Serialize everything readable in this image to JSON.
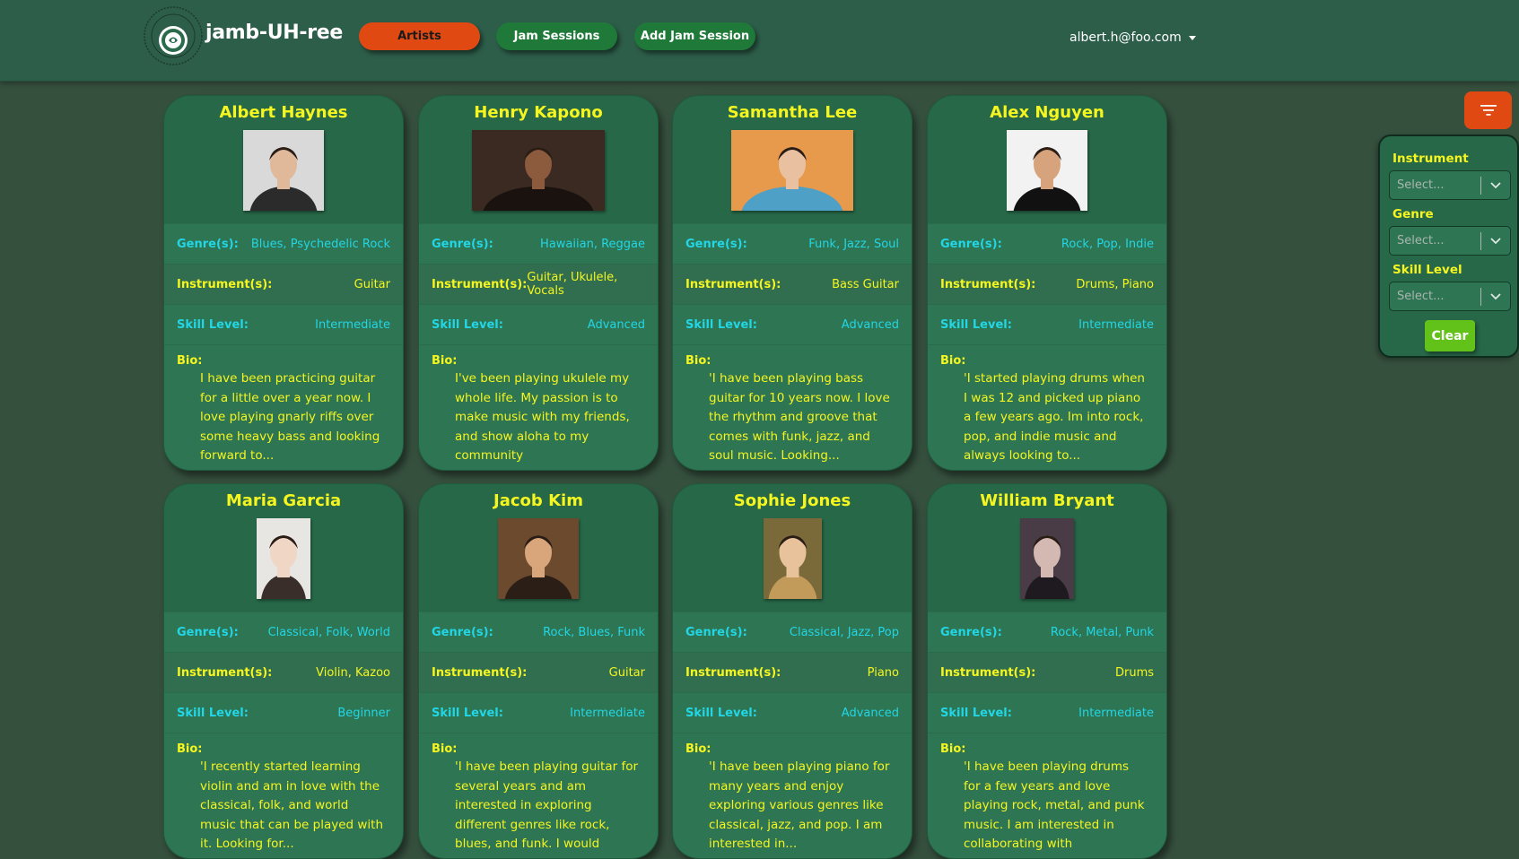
{
  "app": {
    "brand_name": "jamb-UH-ree",
    "logo_text": "JAMB-UH-REE"
  },
  "nav": {
    "artists": "Artists",
    "jam_sessions": "Jam Sessions",
    "add_jam_session": "Add Jam Session",
    "user_email": "albert.h@foo.com"
  },
  "labels": {
    "genres": "Genre(s):",
    "instruments": "Instrument(s):",
    "skill": "Skill Level:",
    "bio": "Bio:"
  },
  "artists": [
    {
      "name": "Albert Haynes",
      "genres": "Blues, Psychedelic Rock",
      "instruments": "Guitar",
      "skill": "Intermediate",
      "bio": "I have been practicing guitar for a little over a year now. I love playing gnarly riffs over some heavy bass and looking forward to..."
    },
    {
      "name": "Henry Kapono",
      "genres": "Hawaiian, Reggae",
      "instruments": "Guitar, Ukulele, Vocals",
      "skill": "Advanced",
      "bio": "I've been playing ukulele my whole life. My passion is to make music with my friends, and show aloha to my community"
    },
    {
      "name": "Samantha Lee",
      "genres": "Funk, Jazz, Soul",
      "instruments": "Bass Guitar",
      "skill": "Advanced",
      "bio": "'I have been playing bass guitar for 10 years now. I love the rhythm and groove that comes with funk, jazz, and soul music. Looking..."
    },
    {
      "name": "Alex Nguyen",
      "genres": "Rock, Pop, Indie",
      "instruments": "Drums, Piano",
      "skill": "Intermediate",
      "bio": "'I started playing drums when I was 12 and picked up piano a few years ago. Im into rock, pop, and indie music and always looking to..."
    },
    {
      "name": "Maria Garcia",
      "genres": "Classical, Folk, World",
      "instruments": "Violin, Kazoo",
      "skill": "Beginner",
      "bio": "'I recently started learning violin and am in love with the classical, folk, and world music that can be played with it. Looking for..."
    },
    {
      "name": "Jacob Kim",
      "genres": "Rock, Blues, Funk",
      "instruments": "Guitar",
      "skill": "Intermediate",
      "bio": "'I have been playing guitar for several years and am interested in exploring different genres like rock, blues, and funk. I would"
    },
    {
      "name": "Sophie Jones",
      "genres": "Classical, Jazz, Pop",
      "instruments": "Piano",
      "skill": "Advanced",
      "bio": "'I have been playing piano for many years and enjoy exploring various genres like classical, jazz, and pop. I am interested in..."
    },
    {
      "name": "William Bryant",
      "genres": "Rock, Metal, Punk",
      "instruments": "Drums",
      "skill": "Intermediate",
      "bio": "'I have been playing drums for a few years and love playing rock, metal, and punk music. I am interested in collaborating with"
    }
  ],
  "filter": {
    "instrument_label": "Instrument",
    "genre_label": "Genre",
    "skill_label": "Skill Level",
    "placeholder": "Select...",
    "clear": "Clear"
  },
  "colors": {
    "accent_orange": "#e04a12",
    "nav_green": "#1f7a3a",
    "card_green": "#276848",
    "text_yellow": "#f5f520",
    "text_cyan": "#22d6e6",
    "clear_green": "#63c21a"
  }
}
